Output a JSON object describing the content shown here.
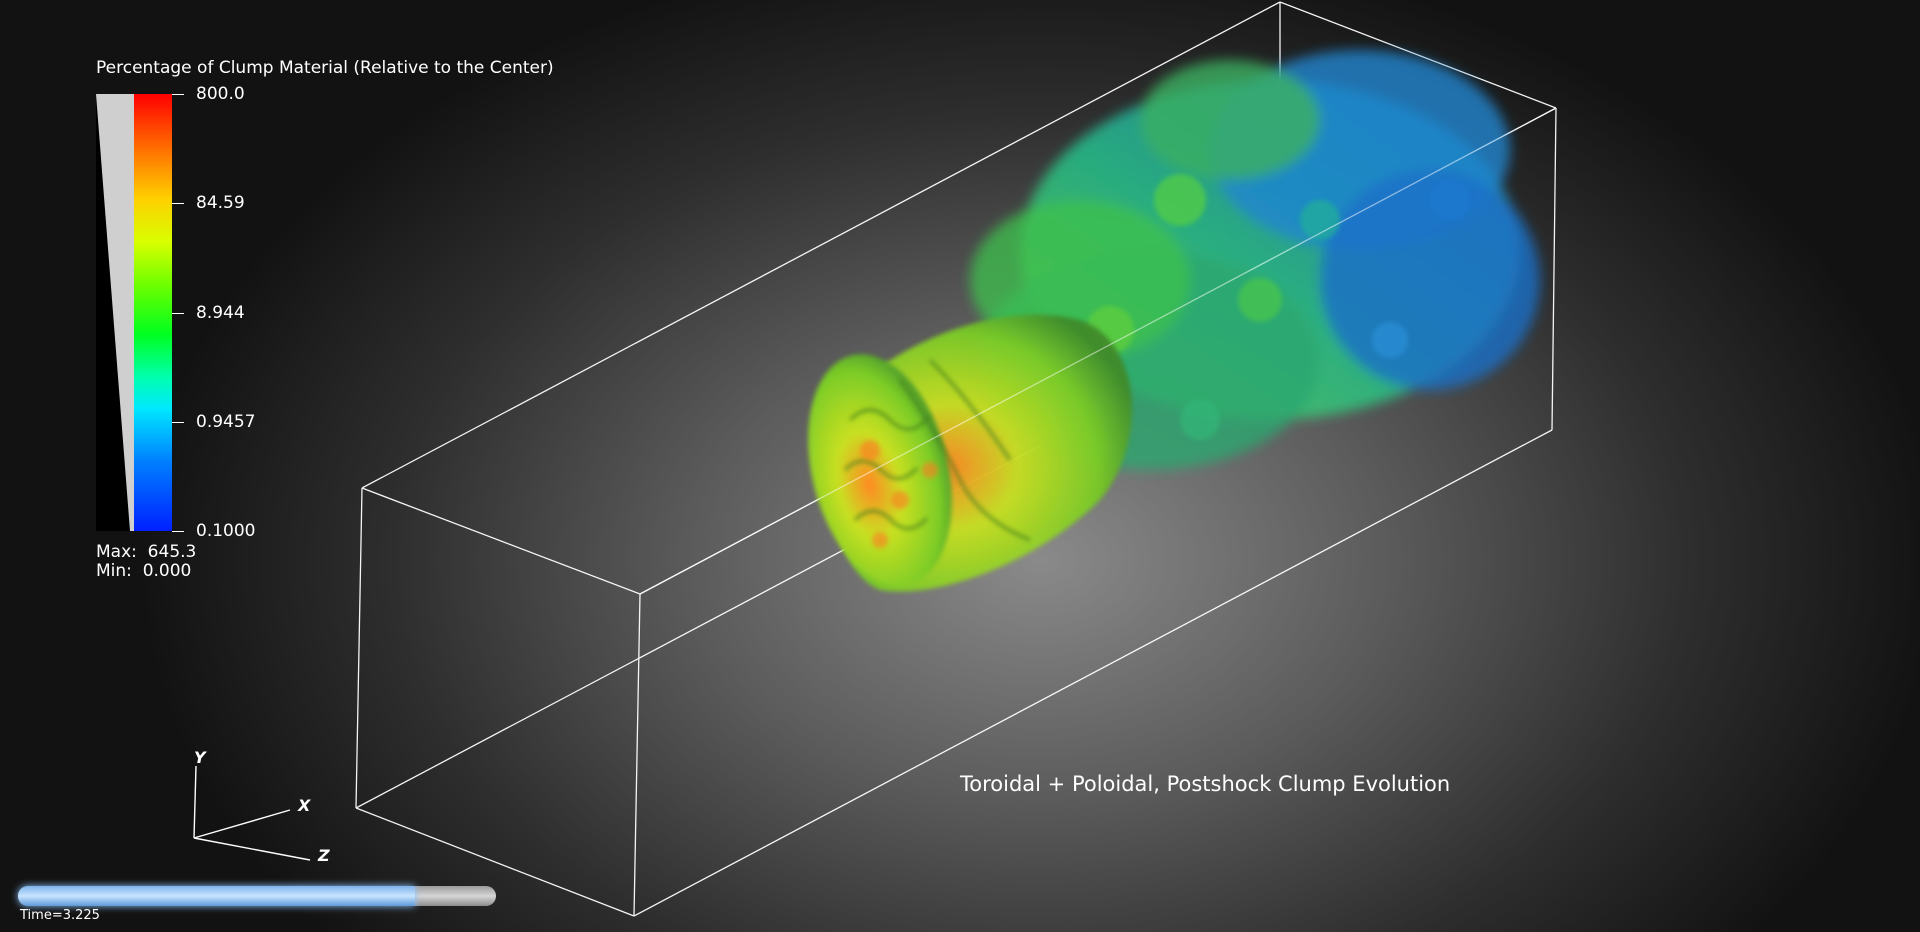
{
  "legend": {
    "title": "Percentage of Clump Material (Relative to the Center)",
    "ticks": [
      "800.0",
      "84.59",
      "8.944",
      "0.9457",
      "0.1000"
    ],
    "max_label": "Max:  645.3",
    "min_label": "Min:  0.000"
  },
  "axes": {
    "y": "Y",
    "x": "X",
    "z": "Z"
  },
  "caption": "Toroidal + Poloidal, Postshock Clump Evolution",
  "time": {
    "label": "Time=3.225",
    "progress": 0.83
  },
  "colors": {
    "accent_progress": "#8cc4ff",
    "outline": "#ffffff",
    "plume_high": "#d8ff00",
    "plume_mid": "#22dd44",
    "plume_low": "#1a7fd6"
  }
}
